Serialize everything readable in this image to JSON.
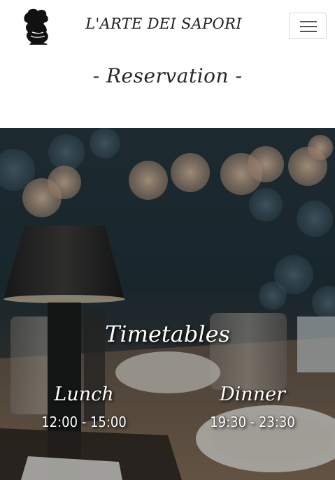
{
  "navbar": {
    "brand": "L'ARTE DEI SAPORI",
    "logo_icon": "chef-silhouette-icon",
    "menu_icon": "hamburger-menu-icon"
  },
  "page": {
    "title": "- Reservation -"
  },
  "timetables": {
    "title": "Timetables",
    "lunch": {
      "label": "Lunch",
      "hours": "12:00 - 15:00"
    },
    "dinner": {
      "label": "Dinner",
      "hours": "19:30 - 23:30"
    }
  },
  "colors": {
    "text_dark": "#222222",
    "hero_overlay": "#1e2e33",
    "hero_text": "#ffffff"
  }
}
